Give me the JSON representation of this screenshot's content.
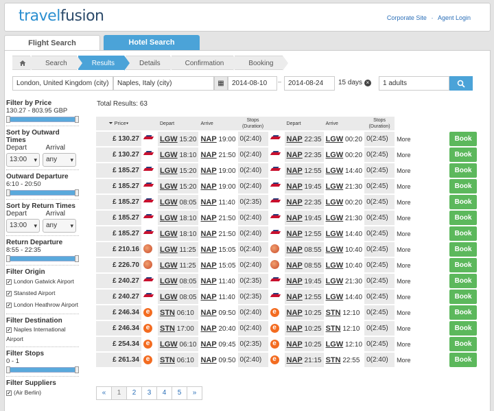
{
  "brand": {
    "part1": "travel",
    "part2": "fusion"
  },
  "toplinks": {
    "corporate": "Corporate Site",
    "sep": "·",
    "agent": "Agent Login"
  },
  "tabs": {
    "flight": "Flight Search",
    "hotel": "Hotel Search"
  },
  "crumbs": [
    "Search",
    "Results",
    "Details",
    "Confirmation",
    "Booking"
  ],
  "search": {
    "from": "London, United Kingdom (city)",
    "to": "Naples, Italy (city)",
    "depart_date": "2014-08-10",
    "dash": "–",
    "return_date": "2014-08-24",
    "days": "15 days",
    "adults": "1 adults"
  },
  "sidebar": {
    "price_title": "Filter by Price",
    "price_range": "130.27 - 803.95 GBP",
    "sort_out_title": "Sort by Outward Times",
    "depart_label": "Depart",
    "arrival_label": "Arrival",
    "sort_out_depart": "13:00",
    "sort_out_arrival": "any",
    "out_dep_title": "Outward Departure",
    "out_dep_range": "6:10 - 20:50",
    "sort_ret_title": "Sort by Return Times",
    "sort_ret_depart": "13:00",
    "sort_ret_arrival": "any",
    "ret_dep_title": "Return Departure",
    "ret_dep_range": "8:55 - 22:35",
    "origin_title": "Filter Origin",
    "origins": [
      "London Gatwick Airport",
      "Stansted Airport",
      "London Heathrow Airport"
    ],
    "dest_title": "Filter Destination",
    "dest": "Naples International Airport",
    "stops_title": "Filter Stops",
    "stops_range": "0 - 1",
    "suppliers_title": "Filter Suppliers",
    "supplier1": "(Air Berlin)"
  },
  "results": {
    "total": "Total Results: 63",
    "headers": {
      "price": "Price",
      "depart": "Depart",
      "arrive": "Arrive",
      "stops": "Stops",
      "duration": "(Duration)"
    },
    "more": "More",
    "book": "Book",
    "rows": [
      {
        "price": "£ 130.27",
        "ol": "ba",
        "od": "LGW",
        "odt": "15:20",
        "oa": "NAP",
        "oat": "19:00",
        "os": "0(2:40)",
        "rl": "ba",
        "rd": "NAP",
        "rdt": "22:35",
        "ra": "LGW",
        "rat": "00:20",
        "rs": "0(2:45)"
      },
      {
        "price": "£ 130.27",
        "ol": "ba",
        "od": "LGW",
        "odt": "18:10",
        "oa": "NAP",
        "oat": "21:50",
        "os": "0(2:40)",
        "rl": "ba",
        "rd": "NAP",
        "rdt": "22:35",
        "ra": "LGW",
        "rat": "00:20",
        "rs": "0(2:45)"
      },
      {
        "price": "£ 185.27",
        "ol": "ba",
        "od": "LGW",
        "odt": "15:20",
        "oa": "NAP",
        "oat": "19:00",
        "os": "0(2:40)",
        "rl": "ba",
        "rd": "NAP",
        "rdt": "12:55",
        "ra": "LGW",
        "rat": "14:40",
        "rs": "0(2:45)"
      },
      {
        "price": "£ 185.27",
        "ol": "ba",
        "od": "LGW",
        "odt": "15:20",
        "oa": "NAP",
        "oat": "19:00",
        "os": "0(2:40)",
        "rl": "ba",
        "rd": "NAP",
        "rdt": "19:45",
        "ra": "LGW",
        "rat": "21:30",
        "rs": "0(2:45)"
      },
      {
        "price": "£ 185.27",
        "ol": "ba",
        "od": "LGW",
        "odt": "08:05",
        "oa": "NAP",
        "oat": "11:40",
        "os": "0(2:35)",
        "rl": "ba",
        "rd": "NAP",
        "rdt": "22:35",
        "ra": "LGW",
        "rat": "00:20",
        "rs": "0(2:45)"
      },
      {
        "price": "£ 185.27",
        "ol": "ba",
        "od": "LGW",
        "odt": "18:10",
        "oa": "NAP",
        "oat": "21:50",
        "os": "0(2:40)",
        "rl": "ba",
        "rd": "NAP",
        "rdt": "19:45",
        "ra": "LGW",
        "rat": "21:30",
        "rs": "0(2:45)"
      },
      {
        "price": "£ 185.27",
        "ol": "ba",
        "od": "LGW",
        "odt": "18:10",
        "oa": "NAP",
        "oat": "21:50",
        "os": "0(2:40)",
        "rl": "ba",
        "rd": "NAP",
        "rdt": "12:55",
        "ra": "LGW",
        "rat": "14:40",
        "rs": "0(2:45)"
      },
      {
        "price": "£ 210.16",
        "ol": "ball",
        "od": "LGW",
        "odt": "11:25",
        "oa": "NAP",
        "oat": "15:05",
        "os": "0(2:40)",
        "rl": "ball",
        "rd": "NAP",
        "rdt": "08:55",
        "ra": "LGW",
        "rat": "10:40",
        "rs": "0(2:45)"
      },
      {
        "price": "£ 226.70",
        "ol": "ball",
        "od": "LGW",
        "odt": "11:25",
        "oa": "NAP",
        "oat": "15:05",
        "os": "0(2:40)",
        "rl": "ball",
        "rd": "NAP",
        "rdt": "08:55",
        "ra": "LGW",
        "rat": "10:40",
        "rs": "0(2:45)"
      },
      {
        "price": "£ 240.27",
        "ol": "ba",
        "od": "LGW",
        "odt": "08:05",
        "oa": "NAP",
        "oat": "11:40",
        "os": "0(2:35)",
        "rl": "ba",
        "rd": "NAP",
        "rdt": "19:45",
        "ra": "LGW",
        "rat": "21:30",
        "rs": "0(2:45)"
      },
      {
        "price": "£ 240.27",
        "ol": "ba",
        "od": "LGW",
        "odt": "08:05",
        "oa": "NAP",
        "oat": "11:40",
        "os": "0(2:35)",
        "rl": "ba",
        "rd": "NAP",
        "rdt": "12:55",
        "ra": "LGW",
        "rat": "14:40",
        "rs": "0(2:45)"
      },
      {
        "price": "£ 246.34",
        "ol": "ez",
        "od": "STN",
        "odt": "06:10",
        "oa": "NAP",
        "oat": "09:50",
        "os": "0(2:40)",
        "rl": "ez",
        "rd": "NAP",
        "rdt": "10:25",
        "ra": "STN",
        "rat": "12:10",
        "rs": "0(2:45)"
      },
      {
        "price": "£ 246.34",
        "ol": "ez",
        "od": "STN",
        "odt": "17:00",
        "oa": "NAP",
        "oat": "20:40",
        "os": "0(2:40)",
        "rl": "ez",
        "rd": "NAP",
        "rdt": "10:25",
        "ra": "STN",
        "rat": "12:10",
        "rs": "0(2:45)"
      },
      {
        "price": "£ 254.34",
        "ol": "ez",
        "od": "LGW",
        "odt": "06:10",
        "oa": "NAP",
        "oat": "09:45",
        "os": "0(2:35)",
        "rl": "ez",
        "rd": "NAP",
        "rdt": "10:25",
        "ra": "LGW",
        "rat": "12:10",
        "rs": "0(2:45)"
      },
      {
        "price": "£ 261.34",
        "ol": "ez",
        "od": "STN",
        "odt": "06:10",
        "oa": "NAP",
        "oat": "09:50",
        "os": "0(2:40)",
        "rl": "ez",
        "rd": "NAP",
        "rdt": "21:15",
        "ra": "STN",
        "rat": "22:55",
        "rs": "0(2:40)"
      }
    ]
  },
  "pagination": [
    "«",
    "1",
    "2",
    "3",
    "4",
    "5",
    "»"
  ]
}
